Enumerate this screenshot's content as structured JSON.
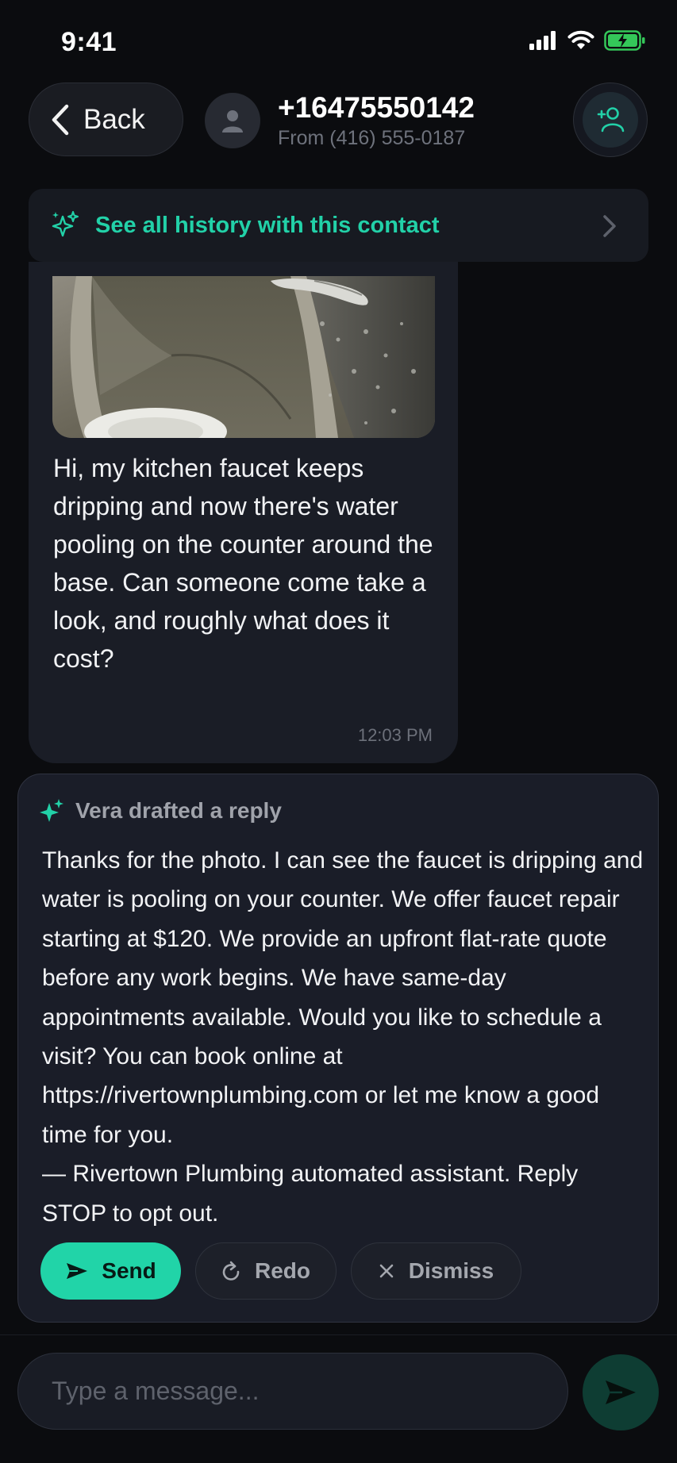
{
  "status_bar": {
    "time": "9:41",
    "icons": [
      "signal-icon",
      "wifi-icon",
      "battery-charging-icon"
    ]
  },
  "header": {
    "back_label": "Back",
    "contact_number": "+16475550142",
    "contact_subtitle": "From (416) 555-0187",
    "add_contact_icon": "add-person-icon"
  },
  "history_banner": {
    "label": "See all history with this contact",
    "icon": "sparkle-icon"
  },
  "incoming_message": {
    "image": "photo of a dripping kitchen faucet over a sink",
    "text": "Hi, my kitchen faucet keeps dripping and now there's water pooling on the counter around the base. Can someone come take a look, and roughly what does it cost?",
    "time": "12:03 PM"
  },
  "draft": {
    "title": "Vera drafted a reply",
    "body_main": "Thanks for the photo. I can see the faucet is dripping and water is pooling on your counter. We offer faucet repair starting at $120. We provide an upfront flat-rate quote before any work begins. We have same-day appointments available. Would you like to schedule a visit? You can book online at https://rivertownplumbing.com or let me know a good time for you.",
    "body_signature": "— Rivertown Plumbing automated assistant. Reply STOP to opt out.",
    "send_label": "Send",
    "redo_label": "Redo",
    "dismiss_label": "Dismiss"
  },
  "composer": {
    "placeholder": "Type a message..."
  },
  "colors": {
    "accent": "#22d1a8",
    "background": "#0b0c0f",
    "card": "#1a1d28",
    "bubble": "#1a1d26"
  }
}
